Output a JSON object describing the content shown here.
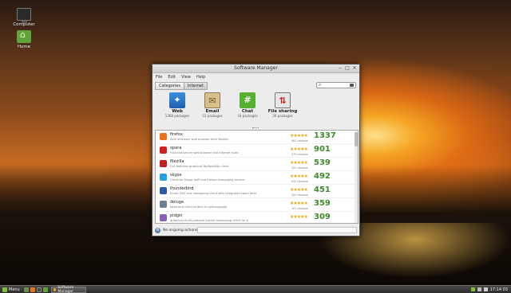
{
  "desktop": {
    "icons": [
      {
        "label": "Computer",
        "icon": "computer-icon"
      },
      {
        "label": "Home",
        "icon": "home-folder-icon"
      }
    ]
  },
  "window": {
    "title": "Software Manager",
    "menu": [
      "File",
      "Edit",
      "View",
      "Help"
    ],
    "breadcrumbs": [
      "Categories",
      "Internet"
    ],
    "search": {
      "placeholder": "",
      "value": ""
    }
  },
  "categories": [
    {
      "name": "Web",
      "count": "1368 packages",
      "icon": "web-compass-icon",
      "color": "#2a72c8"
    },
    {
      "name": "Email",
      "count": "51 packages",
      "icon": "email-envelope-icon",
      "color": "#d8c08a"
    },
    {
      "name": "Chat",
      "count": "33 packages",
      "icon": "chat-hash-icon",
      "color": "#58b030"
    },
    {
      "name": "File sharing",
      "count": "26 packages",
      "icon": "file-sharing-icon",
      "color": "#e6e6e6"
    }
  ],
  "apps": [
    {
      "name": "firefox",
      "desc": "Safe and easy web browser from Mozilla",
      "reviews": "481 reviews",
      "score": "1337",
      "stars": "★★★★★",
      "rating_out_of_5": 4.5,
      "icon_color": "#e8731c"
    },
    {
      "name": "opera",
      "desc": "Fast and secure web browser and Internet suite",
      "reviews": "379 reviews",
      "score": "901",
      "stars": "★★★★★",
      "rating_out_of_5": 4.5,
      "icon_color": "#d41f1f"
    },
    {
      "name": "filezilla",
      "desc": "Full-featured graphical ftp/ftps/sftp client",
      "reviews": "322 reviews",
      "score": "539",
      "stars": "★★★★★",
      "rating_out_of_5": 4.5,
      "icon_color": "#c42020"
    },
    {
      "name": "skype",
      "desc": "Client for Skype VoIP and Instant messaging service",
      "reviews": "531 reviews",
      "score": "492",
      "stars": "★★★★★",
      "rating_out_of_5": 4,
      "icon_color": "#22a0e0"
    },
    {
      "name": "thunderbird",
      "desc": "Email, RSS and newsgroup client with integrated spam filter",
      "reviews": "300 reviews",
      "score": "451",
      "stars": "★★★★★",
      "rating_out_of_5": 4.5,
      "icon_color": "#2b5aa8"
    },
    {
      "name": "deluge",
      "desc": "bittorrent client written in python/pygtk",
      "reviews": "107 reviews",
      "score": "359",
      "stars": "★★★★★",
      "rating_out_of_5": 4.5,
      "icon_color": "#6d7f95"
    },
    {
      "name": "pidgin",
      "desc": "graphical multi-protocol instant messaging client for X",
      "reviews": "",
      "score": "309",
      "stars": "★★★★★",
      "rating_out_of_5": 4,
      "icon_color": "#8a5fb8"
    }
  ],
  "status": {
    "text": "No ongoing actions"
  },
  "taskbar": {
    "menu_label": "Menu",
    "task_label": "Software Manager",
    "clock": "17:14 03"
  }
}
